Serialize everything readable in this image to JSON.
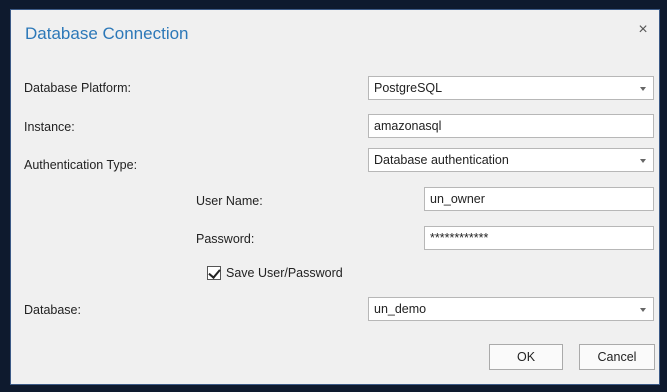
{
  "dialog": {
    "title": "Database Connection",
    "close_icon": "close-icon",
    "close_glyph": "×"
  },
  "form": {
    "platform": {
      "label": "Database Platform:",
      "value": "PostgreSQL"
    },
    "instance": {
      "label": "Instance:",
      "value": "amazonasql"
    },
    "auth_type": {
      "label": "Authentication Type:",
      "value": "Database authentication"
    },
    "username": {
      "label": "User Name:",
      "value": "un_owner"
    },
    "password": {
      "label": "Password:",
      "value": "************"
    },
    "save_credentials": {
      "label": "Save User/Password",
      "checked": true
    },
    "database": {
      "label": "Database:",
      "value": "un_demo"
    }
  },
  "buttons": {
    "ok": "OK",
    "cancel": "Cancel"
  },
  "colors": {
    "title": "#2c78b8",
    "backdrop": "#0e1a2e",
    "dialog_bg": "#f0f0f0"
  }
}
